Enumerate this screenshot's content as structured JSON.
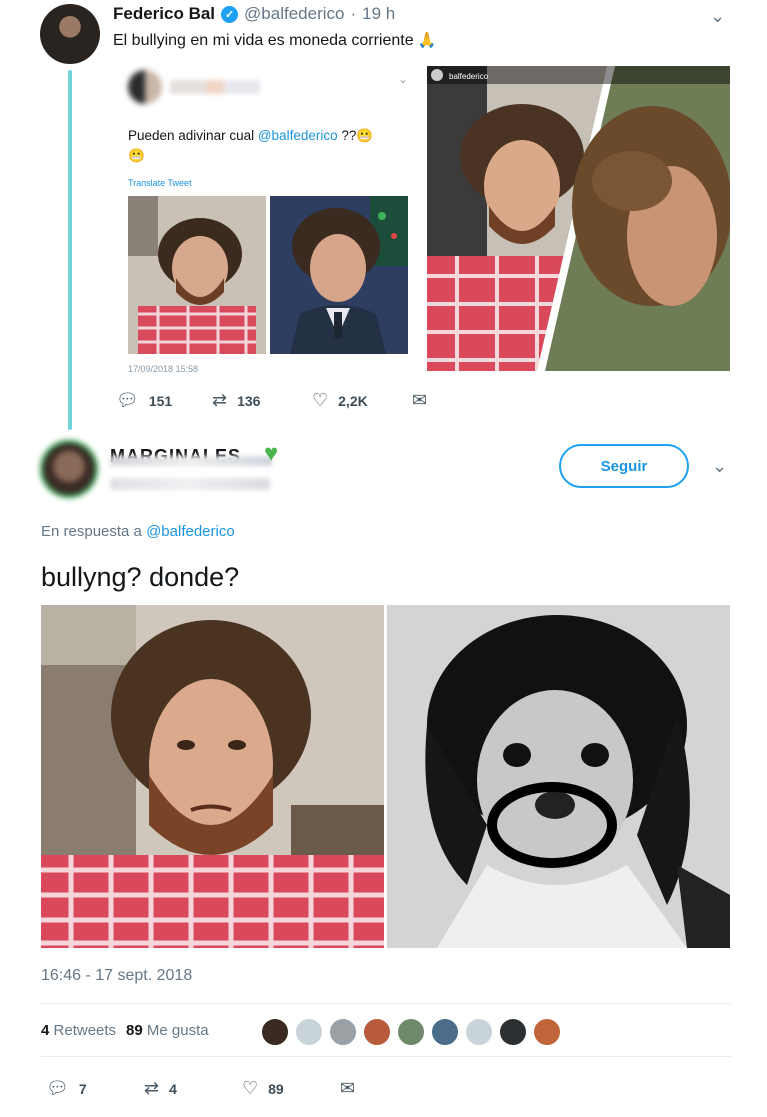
{
  "tweet1": {
    "display_name": "Federico Bal",
    "handle": "@balfederico",
    "separator": "·",
    "time": "19 h",
    "text": "El bullying en mi vida es moneda corriente",
    "quoted": {
      "text_before": "Pueden adivinar cual ",
      "mention": "@balfederico",
      "text_after": " ??",
      "translate": "Translate Tweet",
      "date": "17/09/2018 15:58"
    },
    "photo_caption": "balfederico",
    "actions": {
      "replies": "151",
      "retweets": "136",
      "likes": "2,2K"
    }
  },
  "tweet2": {
    "display_name": "MARGINALES",
    "follow_label": "Seguir",
    "reply_prefix": "En respuesta a",
    "reply_handle": "@balfederico",
    "text": "bullyng? donde?",
    "timestamp": "16:46 - 17 sept. 2018",
    "stats": {
      "retweets_count": "4",
      "retweets_label": "Retweets",
      "likes_count": "89",
      "likes_label": "Me gusta"
    },
    "actions": {
      "replies": "7",
      "retweets": "4",
      "likes": "89"
    }
  },
  "icons": {
    "reply": "reply-icon",
    "retweet": "retweet-icon",
    "like": "heart-icon",
    "message": "message-icon",
    "chevron": "chevron-down-icon",
    "verified": "verified-badge-icon"
  },
  "colors": {
    "accent": "#1da1f2",
    "thread_line": "#6fd3d8",
    "muted": "#657786"
  }
}
